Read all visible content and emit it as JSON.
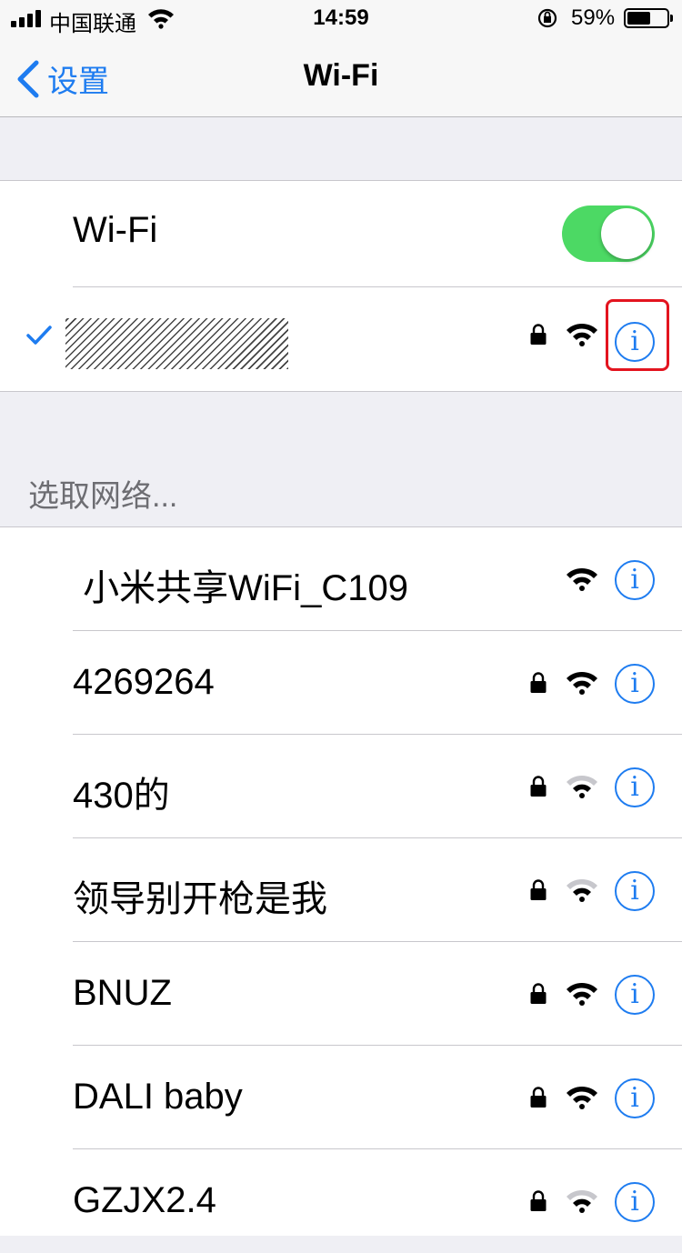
{
  "status": {
    "carrier": "中国联通",
    "time": "14:59",
    "battery": "59%",
    "battery_level": 0.59
  },
  "nav": {
    "back_label": "设置",
    "title": "Wi-Fi"
  },
  "wifi_toggle": {
    "label": "Wi-Fi",
    "on": true
  },
  "connected": {
    "name": "",
    "secured": true
  },
  "networks_header": "选取网络...",
  "networks": [
    {
      "name": " 小米共享WiFi_C109",
      "secured": false,
      "strength": "strong"
    },
    {
      "name": "4269264",
      "secured": true,
      "strength": "strong"
    },
    {
      "name": "430的",
      "secured": true,
      "strength": "medium"
    },
    {
      "name": "领导别开枪是我",
      "secured": true,
      "strength": "medium"
    },
    {
      "name": "BNUZ",
      "secured": true,
      "strength": "strong"
    },
    {
      "name": "DALI baby",
      "secured": true,
      "strength": "strong"
    },
    {
      "name": "GZJX2.4",
      "secured": true,
      "strength": "medium"
    }
  ],
  "colors": {
    "accent": "#1e7cf0",
    "toggle_on": "#4cd964",
    "highlight": "#e3141f"
  }
}
